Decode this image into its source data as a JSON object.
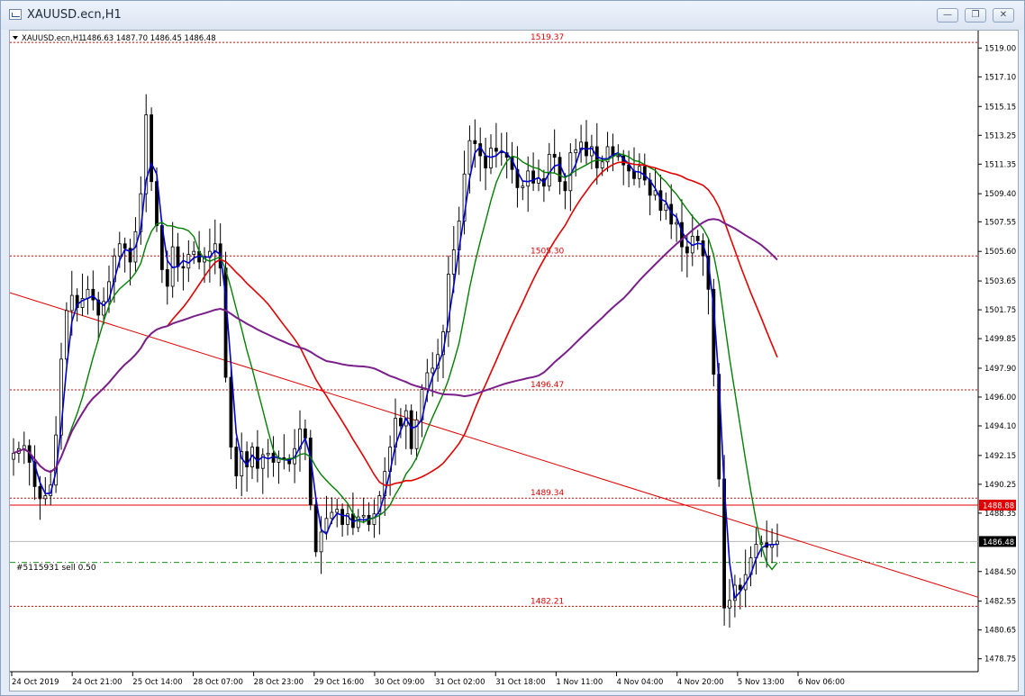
{
  "window": {
    "title": "XAUUSD.ecn,H1",
    "minimize_icon": "minimize-icon",
    "restore_icon": "restore-icon",
    "close_icon": "close-icon"
  },
  "chart_header": {
    "symbol": "XAUUSD.ecn,H1",
    "ohlc": "1486.63 1487.70 1486.45 1486.48"
  },
  "order_label": "#5115931 sell 0.50",
  "colors": {
    "bg": "#ffffff",
    "candle": "#000000",
    "ma_fast": "#0000cc",
    "ma_green": "#008000",
    "ma_red": "#e00000",
    "ma_purple": "#7a1f8a",
    "level_line": "#e00000",
    "order_line": "#1a8a1a"
  },
  "chart_data": {
    "type": "candlestick",
    "title": "XAUUSD.ecn,H1",
    "ylim": [
      1477.9,
      1520.15
    ],
    "y_ticks": [
      "1519.00",
      "1517.10",
      "1515.15",
      "1513.25",
      "1511.35",
      "1509.40",
      "1507.55",
      "1505.60",
      "1503.65",
      "1501.75",
      "1499.85",
      "1497.90",
      "1496.00",
      "1494.10",
      "1492.15",
      "1490.25",
      "1488.35",
      "1484.50",
      "1482.55",
      "1480.65",
      "1478.75"
    ],
    "x_ticks": [
      "24 Oct 2019",
      "24 Oct 21:00",
      "25 Oct 14:00",
      "28 Oct 07:00",
      "28 Oct 23:00",
      "29 Oct 16:00",
      "30 Oct 09:00",
      "31 Oct 02:00",
      "31 Oct 18:00",
      "1 Nov 11:00",
      "4 Nov 04:00",
      "4 Nov 20:00",
      "5 Nov 13:00",
      "6 Nov 06:00"
    ],
    "levels": [
      {
        "label": "1519.37",
        "value": 1519.37
      },
      {
        "label": "1505.30",
        "value": 1505.3
      },
      {
        "label": "1496.47",
        "value": 1496.47
      },
      {
        "label": "1489.34",
        "value": 1489.34
      },
      {
        "label": "1482.21",
        "value": 1482.21
      }
    ],
    "bid_line": {
      "label": "1488.88",
      "value": 1488.88
    },
    "current_price": {
      "label": "1486.48",
      "value": 1486.48
    },
    "order_price": 1485.1,
    "trendline": {
      "from": [
        0,
        1502.8
      ],
      "to": [
        161,
        1485.1
      ]
    },
    "closes": [
      1492.3,
      1492.6,
      1492.8,
      1491.7,
      1490.1,
      1489.3,
      1489.5,
      1490.2,
      1493.5,
      1498.5,
      1501.7,
      1502.7,
      1501.9,
      1502.5,
      1503.1,
      1502.4,
      1501.4,
      1502.3,
      1503.6,
      1505.3,
      1506.1,
      1505.8,
      1504.9,
      1506.9,
      1509.4,
      1514.6,
      1510.2,
      1507.3,
      1504.4,
      1503.3,
      1505.9,
      1504.6,
      1504.5,
      1505.4,
      1505.6,
      1504.9,
      1505.2,
      1505.6,
      1506.1,
      1504.5,
      1497.3,
      1492.7,
      1490.8,
      1492.4,
      1491.4,
      1492.7,
      1491.3,
      1492.2,
      1492.3,
      1491.7,
      1492.0,
      1491.9,
      1491.6,
      1492.6,
      1493.9,
      1493.3,
      1488.9,
      1485.8,
      1487.1,
      1488.0,
      1488.4,
      1488.6,
      1487.6,
      1488.3,
      1487.4,
      1488.1,
      1488.2,
      1487.6,
      1488.3,
      1489.5,
      1491.1,
      1492.7,
      1494.6,
      1494.1,
      1495.1,
      1492.6,
      1494.5,
      1496.5,
      1497.6,
      1497.9,
      1498.8,
      1500.3,
      1504.1,
      1505.7,
      1507.6,
      1510.7,
      1512.9,
      1512.7,
      1511.9,
      1511.1,
      1512.4,
      1512.2,
      1512.1,
      1511.8,
      1511.0,
      1509.8,
      1509.9,
      1510.9,
      1510.1,
      1510.4,
      1509.9,
      1512.0,
      1511.8,
      1510.2,
      1509.6,
      1512.1,
      1512.3,
      1512.8,
      1511.9,
      1512.5,
      1511.1,
      1511.5,
      1512.5,
      1511.9,
      1511.9,
      1511.3,
      1510.9,
      1510.4,
      1511.2,
      1510.3,
      1509.3,
      1509.6,
      1508.3,
      1508.7,
      1507.4,
      1507.5,
      1505.9,
      1505.5,
      1506.6,
      1506.3,
      1505.3,
      1503.1,
      1497.5,
      1490.6,
      1482.1,
      1482.6,
      1483.6,
      1483.3,
      1484.3,
      1485.4,
      1486.3,
      1486.4,
      1486.1,
      1486.3,
      1486.5
    ]
  }
}
